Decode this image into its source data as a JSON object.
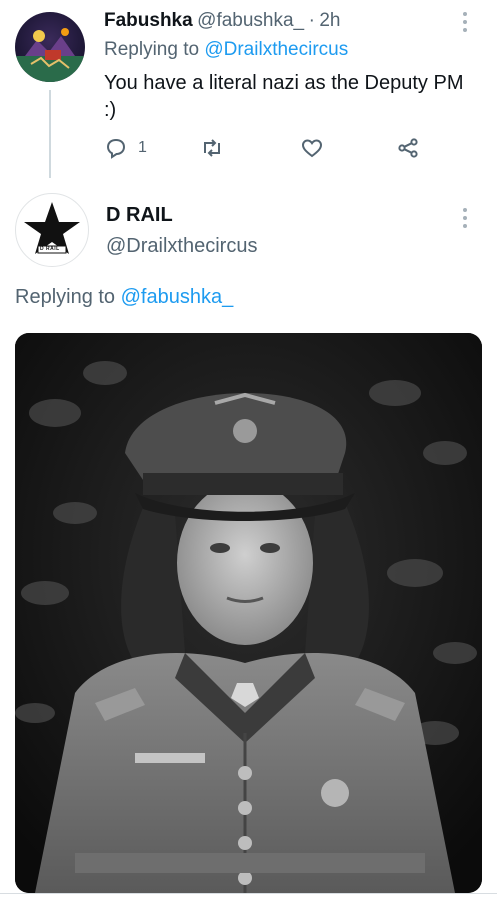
{
  "reply_tweet": {
    "display_name": "Fabushka",
    "handle": "@fabushka_",
    "separator": "·",
    "time": "2h",
    "replying_prefix": "Replying to",
    "replying_handle": "@Drailxthecircus",
    "text": "You have a literal nazi as the Deputy PM :)",
    "actions": {
      "reply_count": "1",
      "reply_icon": "comment-bubble-icon",
      "retweet_icon": "retweet-icon",
      "like_icon": "heart-icon",
      "share_icon": "share-icon"
    }
  },
  "main_tweet": {
    "display_name": "D RAIL",
    "handle": "@Drailxthecircus",
    "avatar_badge_text": "D RAIL",
    "replying_prefix": "Replying to",
    "replying_handle": "@fabushka_",
    "media_description_icon": "photo"
  },
  "colors": {
    "link_blue": "#1d9bf0",
    "secondary_text": "#536471",
    "thread_line": "#cfd9de"
  }
}
